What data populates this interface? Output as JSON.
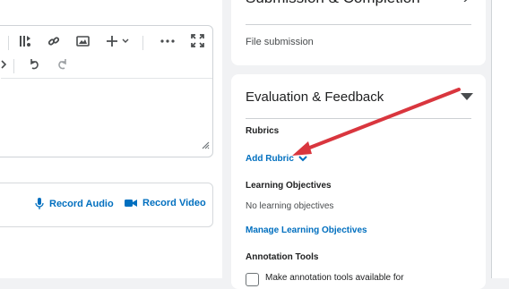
{
  "toolbar": {
    "icons": [
      "media-play-pause-icon",
      "link-icon",
      "image-icon",
      "insert-plus-icon",
      "more-options-icon",
      "fullscreen-icon",
      "code-view-icon",
      "undo-icon",
      "redo-icon",
      "resize-handle-icon"
    ]
  },
  "recorder": {
    "audio_label": "Record Audio",
    "video_label": "Record Video"
  },
  "submission_card": {
    "title": "Submission & Completion",
    "type_text": "File submission"
  },
  "evaluation_card": {
    "title": "Evaluation & Feedback",
    "rubrics_label": "Rubrics",
    "add_rubric_link": "Add Rubric",
    "objectives_label": "Learning Objectives",
    "objectives_text": "No learning objectives",
    "manage_objectives_link": "Manage Learning Objectives",
    "annotation_label": "Annotation Tools",
    "annotation_checkbox_text": "Make annotation tools available for"
  },
  "colors": {
    "link": "#006fbf",
    "annotation_arrow": "#d9363e",
    "page_bg": "#f1f2f4"
  }
}
